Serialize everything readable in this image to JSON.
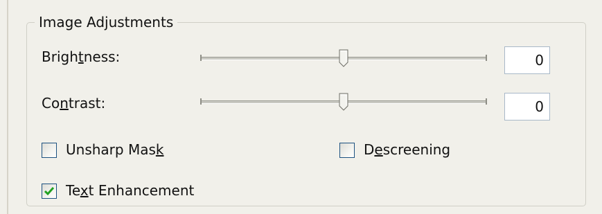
{
  "group": {
    "title": "Image Adjustments"
  },
  "brightness": {
    "label_pre": "Brigh",
    "label_key": "t",
    "label_post": "ness:",
    "value": "0",
    "slider_fraction": 0.5
  },
  "contrast": {
    "label_pre": "Co",
    "label_key": "n",
    "label_post": "trast:",
    "value": "0",
    "slider_fraction": 0.5
  },
  "unsharp_mask": {
    "label_pre": "Unsharp Mas",
    "label_key": "k",
    "label_post": "",
    "checked": false
  },
  "descreening": {
    "label_pre": "D",
    "label_key": "e",
    "label_post": "screening",
    "checked": false
  },
  "text_enhancement": {
    "label_pre": "Te",
    "label_key": "x",
    "label_post": "t Enhancement",
    "checked": true
  },
  "colors": {
    "check_mark": "#21a121",
    "box_border": "#1c5180"
  }
}
